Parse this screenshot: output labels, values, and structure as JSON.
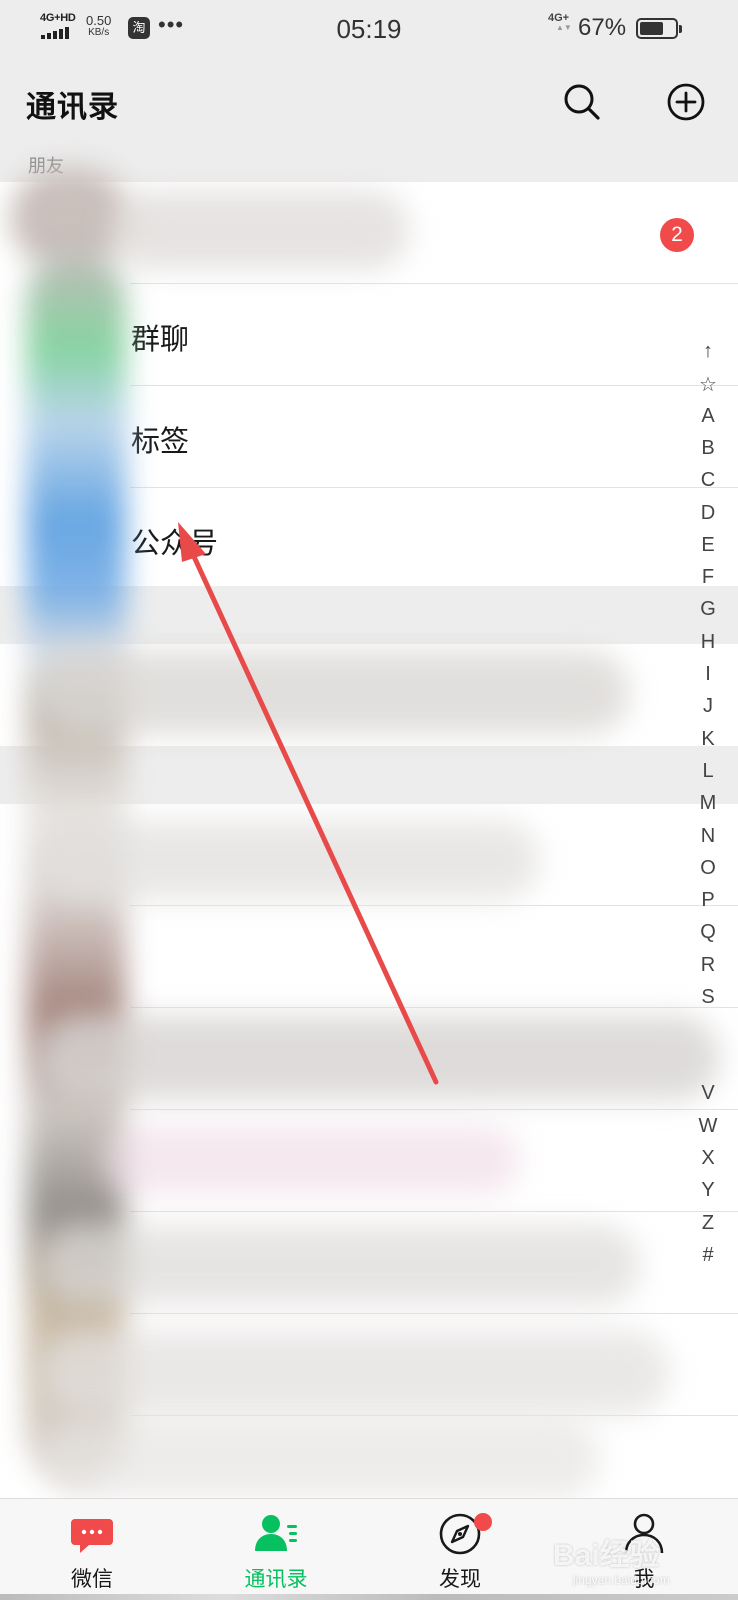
{
  "status_bar": {
    "signal_label": "4G+HD",
    "net_speed_value": "0.50",
    "net_speed_unit": "KB/s",
    "app_notification": "淘",
    "more_dots": "•••",
    "time": "05:19",
    "network_right": "4G+",
    "battery_percent": "67%",
    "battery_level": 0.67
  },
  "header": {
    "title": "通讯录",
    "search_icon": "search-icon",
    "add_icon": "add-circle-icon"
  },
  "section_header": "朋友",
  "new_friends": {
    "badge_count": "2"
  },
  "menu_items": [
    {
      "label": "群聊"
    },
    {
      "label": "标签"
    },
    {
      "label": "公众号"
    }
  ],
  "alphabet_index": [
    "↑",
    "☆",
    "A",
    "B",
    "C",
    "D",
    "E",
    "F",
    "G",
    "H",
    "I",
    "J",
    "K",
    "L",
    "M",
    "N",
    "O",
    "P",
    "Q",
    "R",
    "S",
    "V",
    "W",
    "X",
    "Y",
    "Z",
    "#"
  ],
  "tabs": [
    {
      "label": "微信",
      "icon": "chat-bubble-icon",
      "active": false
    },
    {
      "label": "通讯录",
      "icon": "contacts-icon",
      "active": true
    },
    {
      "label": "发现",
      "icon": "compass-icon",
      "active": false
    },
    {
      "label": "我",
      "icon": "person-icon",
      "active": false
    }
  ],
  "watermark": {
    "brand": "Bai经验",
    "url": "jingyan.baidu.com"
  },
  "colors": {
    "accent_green": "#07c160",
    "badge_red": "#f04a4a",
    "background": "#ededed",
    "annotation_arrow": "#e84a4a"
  }
}
